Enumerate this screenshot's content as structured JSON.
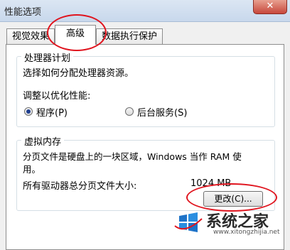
{
  "window": {
    "title": "性能选项",
    "close_glyph": "✕"
  },
  "tabs": [
    {
      "label": "视觉效果",
      "active": false
    },
    {
      "label": "高级",
      "active": true
    },
    {
      "label": "数据执行保护",
      "active": false
    }
  ],
  "processor": {
    "group_title": "处理器计划",
    "description": "选择如何分配处理器资源。",
    "adjust_label": "调整以优化性能:",
    "options": [
      {
        "label": "程序(P)",
        "selected": true
      },
      {
        "label": "后台服务(S)",
        "selected": false
      }
    ]
  },
  "virtual_memory": {
    "group_title": "虚拟内存",
    "description": "分页文件是硬盘上的一块区域，Windows 当作 RAM 使用。",
    "description_line1": "分页文件是硬盘上的一块区域，Windows 当作 RAM 使",
    "description_line2": "用。",
    "total_label": "所有驱动器总分页文件大小:",
    "total_value": "1024 MB",
    "change_button": "更改(C)..."
  },
  "watermark": {
    "text": "系统之家",
    "url": "www.xitongzhijia.net"
  },
  "colors": {
    "callout": "#e0141e",
    "titlebar": "#c8d8ec",
    "close": "#c7473b"
  }
}
